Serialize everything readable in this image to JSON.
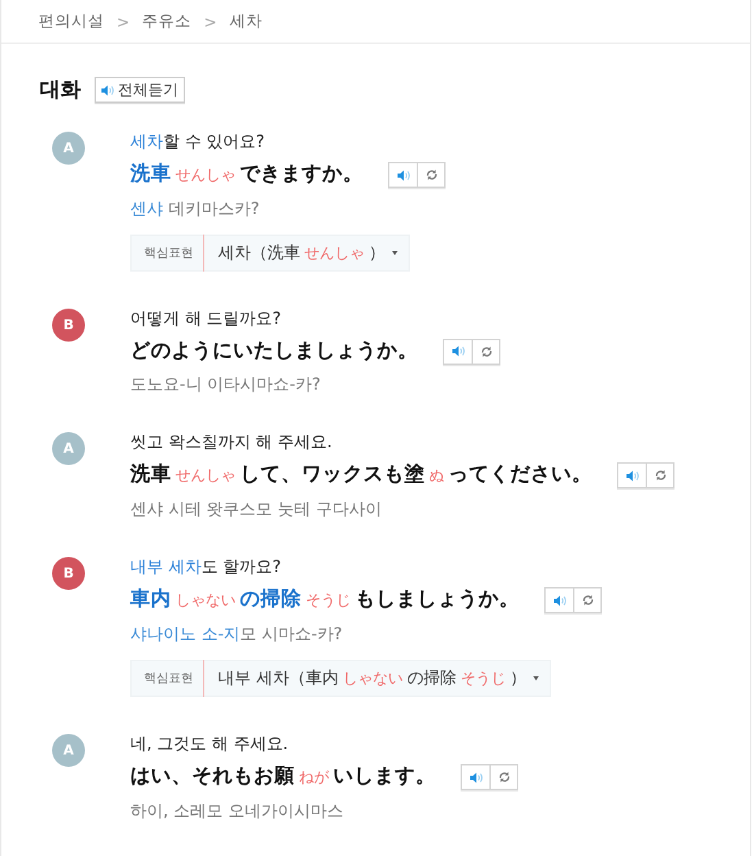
{
  "breadcrumb": {
    "separator": ">",
    "items": [
      "편의시설",
      "주유소",
      "세차"
    ]
  },
  "section": {
    "title": "대화",
    "listen_all": "전체듣기"
  },
  "dialog": [
    {
      "speaker": "A",
      "color": "#a6c0c9",
      "korean": [
        {
          "kind": "key",
          "text": "세차"
        },
        {
          "kind": "text",
          "text": "할 수 있어요?"
        }
      ],
      "japanese": [
        {
          "kind": "key",
          "text": "洗車"
        },
        {
          "kind": "reading",
          "text": "せんしゃ"
        },
        {
          "kind": "text",
          "text": "できますか。"
        }
      ],
      "pronunciation": [
        {
          "kind": "key",
          "text": "센샤"
        },
        {
          "kind": "text",
          "text": " 데키마스카?"
        }
      ],
      "key_expression": {
        "label": "핵심표현",
        "value": [
          {
            "kind": "text",
            "text": "세차（洗車"
          },
          {
            "kind": "reading",
            "text": "せんしゃ"
          },
          {
            "kind": "text",
            "text": "）"
          }
        ]
      }
    },
    {
      "speaker": "B",
      "color": "#d2545e",
      "korean": [
        {
          "kind": "text",
          "text": "어떻게 해 드릴까요?"
        }
      ],
      "japanese": [
        {
          "kind": "text",
          "text": "どのようにいたしましょうか。"
        }
      ],
      "pronunciation": [
        {
          "kind": "text",
          "text": "도노요-니 이타시마쇼-카?"
        }
      ]
    },
    {
      "speaker": "A",
      "color": "#a6c0c9",
      "korean": [
        {
          "kind": "text",
          "text": "씻고 왁스칠까지 해 주세요."
        }
      ],
      "japanese": [
        {
          "kind": "text",
          "text": "洗車"
        },
        {
          "kind": "reading",
          "text": "せんしゃ"
        },
        {
          "kind": "text",
          "text": "して、ワックスも塗"
        },
        {
          "kind": "reading",
          "text": "ぬ"
        },
        {
          "kind": "text",
          "text": "ってください。"
        }
      ],
      "pronunciation": [
        {
          "kind": "text",
          "text": "센샤 시테 왓쿠스모 눗테 구다사이"
        }
      ]
    },
    {
      "speaker": "B",
      "color": "#d2545e",
      "korean": [
        {
          "kind": "key",
          "text": "내부 세차"
        },
        {
          "kind": "text",
          "text": "도 할까요?"
        }
      ],
      "japanese": [
        {
          "kind": "key",
          "text": "車内"
        },
        {
          "kind": "reading",
          "text": "しゃない"
        },
        {
          "kind": "key",
          "text": "の掃除"
        },
        {
          "kind": "reading",
          "text": "そうじ"
        },
        {
          "kind": "text",
          "text": "もしましょうか。"
        }
      ],
      "pronunciation": [
        {
          "kind": "key",
          "text": "샤나이노 소-지"
        },
        {
          "kind": "text",
          "text": "모 시마쇼-카?"
        }
      ],
      "key_expression": {
        "label": "핵심표현",
        "value": [
          {
            "kind": "text",
            "text": "내부 세차（車内"
          },
          {
            "kind": "reading",
            "text": "しゃない"
          },
          {
            "kind": "text",
            "text": "の掃除"
          },
          {
            "kind": "reading",
            "text": "そうじ"
          },
          {
            "kind": "text",
            "text": "）"
          }
        ]
      }
    },
    {
      "speaker": "A",
      "color": "#a6c0c9",
      "korean": [
        {
          "kind": "text",
          "text": "네, 그것도 해 주세요."
        }
      ],
      "japanese": [
        {
          "kind": "text",
          "text": "はい、それもお願"
        },
        {
          "kind": "reading",
          "text": "ねが"
        },
        {
          "kind": "text",
          "text": "いします。"
        }
      ],
      "pronunciation": [
        {
          "kind": "text",
          "text": "하이, 소레모 오네가이시마스"
        }
      ]
    }
  ]
}
